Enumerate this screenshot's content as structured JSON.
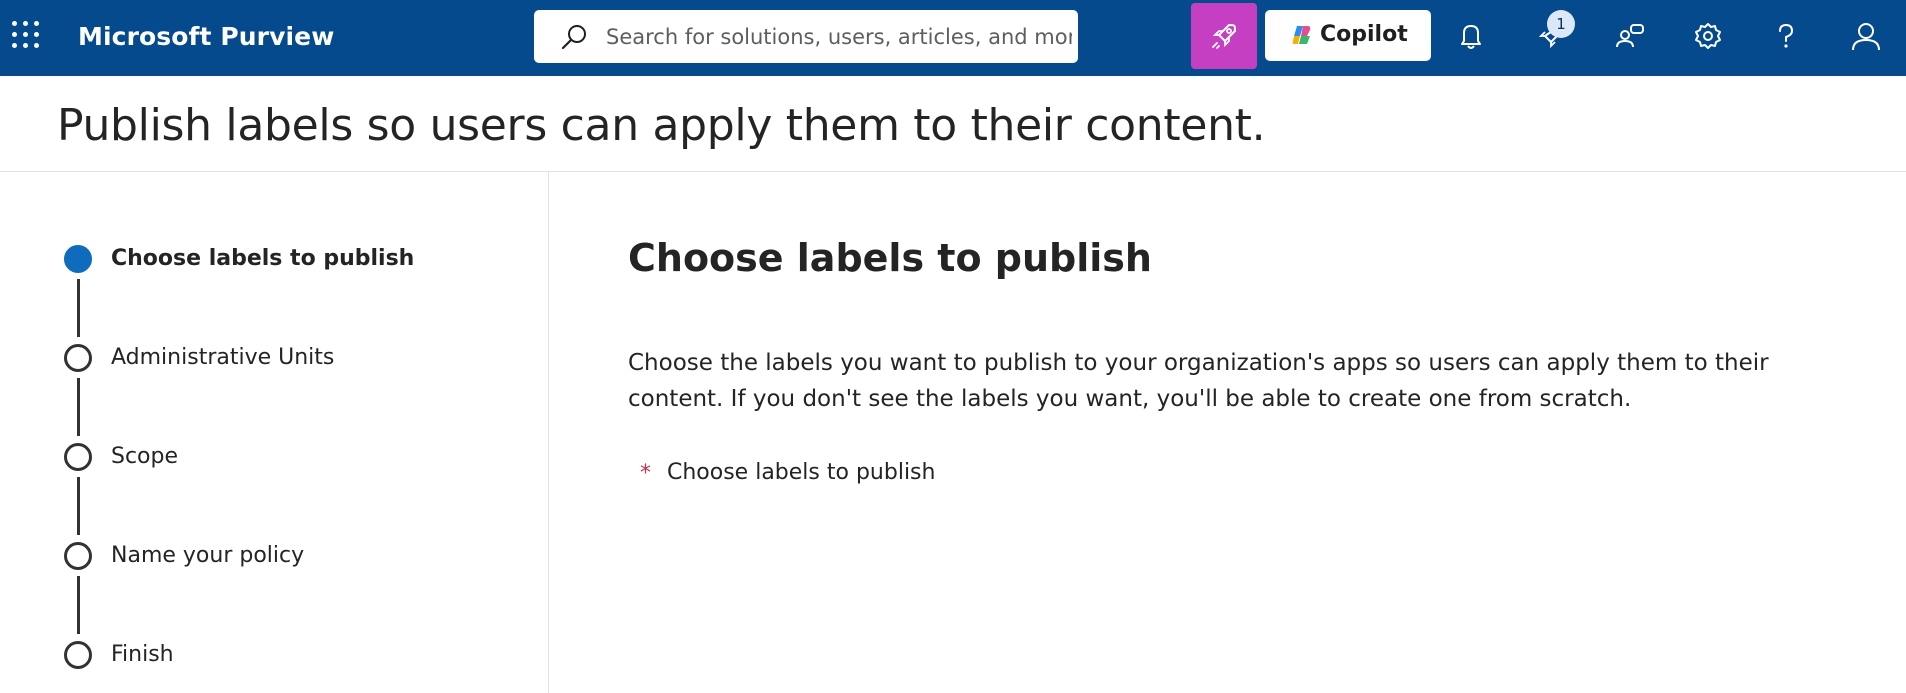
{
  "topbar": {
    "app_title": "Microsoft Purview",
    "search": {
      "placeholder": "Search for solutions, users, articles, and more",
      "value": ""
    },
    "copilot_label": "Copilot",
    "notification_badge": "1",
    "icons": [
      "app-launcher-icon",
      "search-icon",
      "rocket-icon",
      "copilot-logo-icon",
      "bell-icon",
      "rocket-notification-icon",
      "people-icon",
      "gear-icon",
      "help-icon",
      "user-icon"
    ],
    "colors": {
      "bar": "#054a8c",
      "rocket_button": "#c43fc2"
    }
  },
  "page": {
    "title": "Publish labels so users can apply them to their content."
  },
  "stepper": {
    "steps": [
      {
        "label": "Choose labels to publish",
        "active": true
      },
      {
        "label": "Administrative Units",
        "active": false
      },
      {
        "label": "Scope",
        "active": false
      },
      {
        "label": "Name your policy",
        "active": false
      },
      {
        "label": "Finish",
        "active": false
      }
    ],
    "active_color": "#0f6cbd"
  },
  "main": {
    "heading": "Choose labels to publish",
    "description": "Choose the labels you want to publish to your organization's apps so users can apply them to their content. If you don't see the labels you want, you'll be able to create one from scratch.",
    "required_marker": "*",
    "field_label": "Choose labels to publish"
  }
}
